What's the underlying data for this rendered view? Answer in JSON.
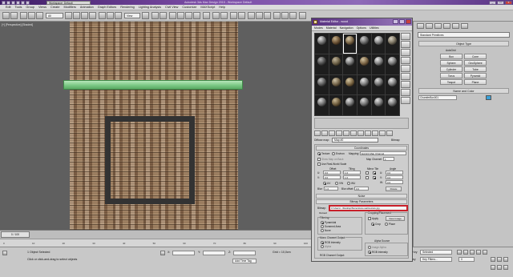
{
  "window": {
    "title": "Autodesk 3ds Max Design 2015 - Workspace Default",
    "workspace": "Workspace: Default",
    "min": "_",
    "max": "□",
    "close": "×"
  },
  "menu": [
    "Edit",
    "Tools",
    "Group",
    "Views",
    "Create",
    "Modifiers",
    "Animation",
    "Graph Editors",
    "Rendering",
    "Lighting Analysis",
    "Civil View",
    "Customize",
    "MAXScript",
    "Help"
  ],
  "toolbar": {
    "selection_filter": "All",
    "view_mode": "View"
  },
  "viewport": {
    "label": "[+] [Perspective] [Shaded]"
  },
  "timeline": {
    "frame": "0 / 100",
    "ticks": [
      "0",
      "10",
      "20",
      "30",
      "40",
      "50",
      "60",
      "70",
      "80",
      "90",
      "100"
    ]
  },
  "status": {
    "selected": "1 Object Selected",
    "prompt": "Click or click-and-drag to select objects",
    "x_label": "X:",
    "y_label": "Y:",
    "z_label": "Z:",
    "grid": "Grid = 10,0cm",
    "autokey": "Auto Key",
    "autokey_value": "Selected",
    "setkey": "Set Key",
    "keyfilters": "Key Filters...",
    "addtimetag": "Add Time Tag",
    "frame_value": "0"
  },
  "command_panel": {
    "dropdown": "Standard Primitives",
    "object_type_title": "Object Type",
    "autogrid": "AutoGrid",
    "buttons": [
      "Box",
      "Cone",
      "Sphere",
      "GeoSphere",
      "Cylinder",
      "Tube",
      "Torus",
      "Pyramid",
      "Teapot",
      "Plane"
    ],
    "name_color_title": "Name and Color",
    "object_name": "ChamferBox001"
  },
  "material_editor": {
    "title": "Material Editor - wood",
    "menu": [
      "Modes",
      "Material",
      "Navigation",
      "Options",
      "Utilities"
    ],
    "name_label": "Diffuse map:",
    "map_name": "Map #0",
    "map_type": "Bitmap",
    "coordinates": {
      "title": "Coordinates",
      "texture": "Texture",
      "environ": "Environ",
      "mapping_label": "Mapping:",
      "mapping_value": "Explicit Map Channel",
      "show_map_on_back": "Show Map on Back",
      "map_channel_label": "Map Channel:",
      "map_channel_value": "1",
      "use_real_world": "Use Real-World Scale",
      "offset_label": "Offset",
      "tiling_label": "Tiling",
      "mirror_tile_label": "Mirror Tile",
      "angle_label": "Angle",
      "u_label": "U:",
      "v_label": "V:",
      "w_label": "W:",
      "u_offset": "0,0",
      "v_offset": "0,0",
      "u_tiling": "1,0",
      "v_tiling": "1,0",
      "u_angle": "0,0",
      "v_angle": "0,0",
      "w_angle": "0,0",
      "uv": "UV",
      "vw": "VW",
      "wu": "WU",
      "blur_label": "Blur:",
      "blur_value": "1,0",
      "blur_offset_label": "Blur offset:",
      "blur_offset_value": "0,0",
      "rotate": "Rotate"
    },
    "noise_title": "Noise",
    "bitmap_params_title": "Bitmap Parameters",
    "bitmap_label": "Bitmap:",
    "bitmap_path": "C:\\Users\\...\\Desktop\\Stone\\stone-wall-texture.jpg",
    "reload": "Reload",
    "cropping": {
      "title": "Cropping/Placement",
      "apply": "Apply",
      "view_image": "View Image",
      "crop": "Crop",
      "place": "Place"
    },
    "filtering": {
      "title": "Filtering",
      "pyramidal": "Pyramidal",
      "summed_area": "Summed Area",
      "none": "None"
    },
    "mono_channel": {
      "title": "Mono Channel Output:",
      "rgb_intensity": "RGB Intensity",
      "alpha": "Alpha"
    },
    "rgb_channel": {
      "title": "RGB Channel Output:"
    },
    "alpha_source": {
      "title": "Alpha Source",
      "image_alpha": "Image Alpha",
      "rgb_intensity": "RGB Intensity"
    }
  }
}
